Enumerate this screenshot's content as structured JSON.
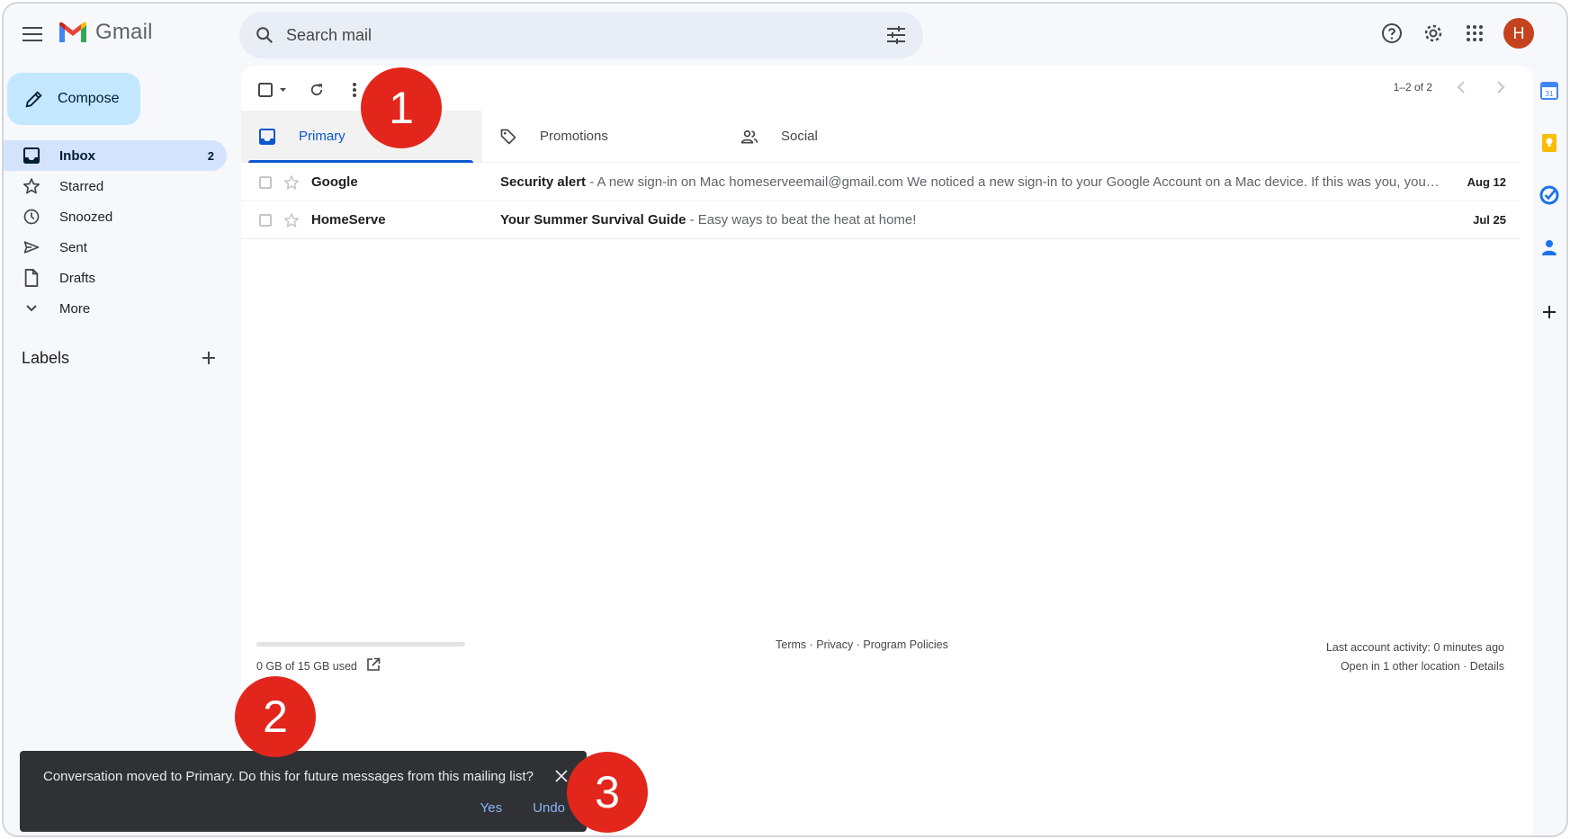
{
  "app": {
    "name": "Gmail",
    "avatar_letter": "H",
    "avatar_color": "#c5421e",
    "accent": "#0b57d0"
  },
  "search": {
    "placeholder": "Search mail"
  },
  "sidebar": {
    "compose_label": "Compose",
    "items": [
      {
        "label": "Inbox",
        "count": "2",
        "icon": "inbox-icon"
      },
      {
        "label": "Starred",
        "icon": "star-icon"
      },
      {
        "label": "Snoozed",
        "icon": "clock-icon"
      },
      {
        "label": "Sent",
        "icon": "send-icon"
      },
      {
        "label": "Drafts",
        "icon": "draft-icon"
      },
      {
        "label": "More",
        "icon": "chevron-down-icon"
      }
    ],
    "labels_title": "Labels"
  },
  "toolbar": {
    "pagination": "1–2 of 2"
  },
  "tabs": [
    {
      "label": "Primary",
      "icon": "inbox-icon"
    },
    {
      "label": "Promotions",
      "icon": "tag-icon"
    },
    {
      "label": "Social",
      "icon": "people-icon"
    }
  ],
  "emails": [
    {
      "sender": "Google",
      "subject": "Security alert",
      "snippet": " - A new sign-in on Mac homeserveemail@gmail.com We noticed a new sign-in to your Google Account on a Mac device. If this was you, you don't need to do anything.",
      "date": "Aug 12"
    },
    {
      "sender": "HomeServe",
      "subject": "Your Summer Survival Guide",
      "snippet": " - Easy ways to beat the heat at home!",
      "date": "Jul 25"
    }
  ],
  "footer": {
    "storage": "0 GB of 15 GB used",
    "links": "Terms · Privacy · Program Policies",
    "activity": "Last account activity: 0 minutes ago",
    "details": "Open in 1 other location · Details"
  },
  "snackbar": {
    "message": "Conversation moved to Primary. Do this for future messages from this mailing list?",
    "yes": "Yes",
    "undo": "Undo"
  },
  "markers": [
    "1",
    "2",
    "3"
  ]
}
